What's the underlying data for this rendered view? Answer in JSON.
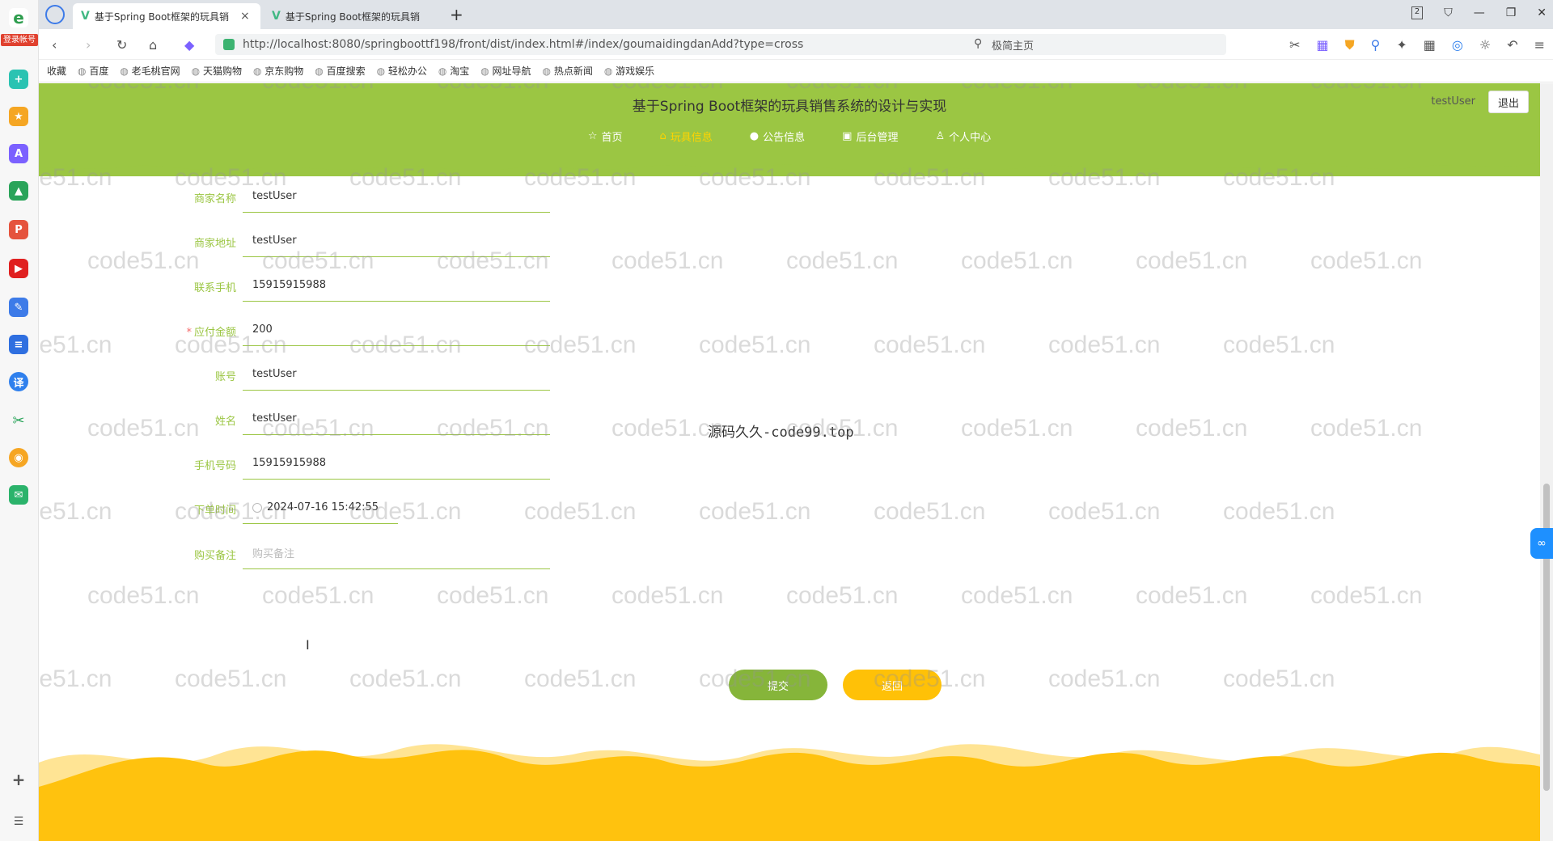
{
  "browser": {
    "login_badge": "登录帐号",
    "tabs": [
      {
        "title": "基于Spring Boot框架的玩具销",
        "active": true
      },
      {
        "title": "基于Spring Boot框架的玩具销",
        "active": false
      }
    ],
    "new_tab": "+",
    "tab_count": "2",
    "url": "http://localhost:8080/springboottf198/front/dist/index.html#/index/goumaidingdanAdd?type=cross",
    "search_placeholder": "极简主页",
    "bookmarks": [
      "收藏",
      "百度",
      "老毛桃官网",
      "天猫购物",
      "京东购物",
      "百度搜索",
      "轻松办公",
      "淘宝",
      "网址导航",
      "热点新闻",
      "游戏娱乐"
    ]
  },
  "header": {
    "title": "基于Spring Boot框架的玩具销售系统的设计与实现",
    "username": "testUser",
    "logout": "退出",
    "menu": [
      {
        "icon": "☆",
        "label": "首页",
        "active": false
      },
      {
        "icon": "⌂",
        "label": "玩具信息",
        "active": true
      },
      {
        "icon": "●",
        "label": "公告信息",
        "active": false
      },
      {
        "icon": "▣",
        "label": "后台管理",
        "active": false
      },
      {
        "icon": "♙",
        "label": "个人中心",
        "active": false
      }
    ]
  },
  "form": {
    "fields": [
      {
        "label": "商家名称",
        "value": "testUser"
      },
      {
        "label": "商家地址",
        "value": "testUser"
      },
      {
        "label": "联系手机",
        "value": "15915915988"
      },
      {
        "label": "应付金额",
        "value": "200",
        "required": true
      },
      {
        "label": "账号",
        "value": "testUser"
      },
      {
        "label": "姓名",
        "value": "testUser"
      },
      {
        "label": "手机号码",
        "value": "15915915988"
      },
      {
        "label": "下单时间",
        "value": "2024-07-16 15:42:55"
      },
      {
        "label": "购买备注",
        "placeholder": "购买备注"
      }
    ],
    "submit": "提交",
    "back": "返回"
  },
  "overlay_text": "源码久久-code99.top",
  "watermark": "code51.cn",
  "colors": {
    "header_green": "#9bc643",
    "submit_green": "#86b53a",
    "back_yellow": "#ffc107",
    "footer_yellow": "#ffc20e"
  }
}
